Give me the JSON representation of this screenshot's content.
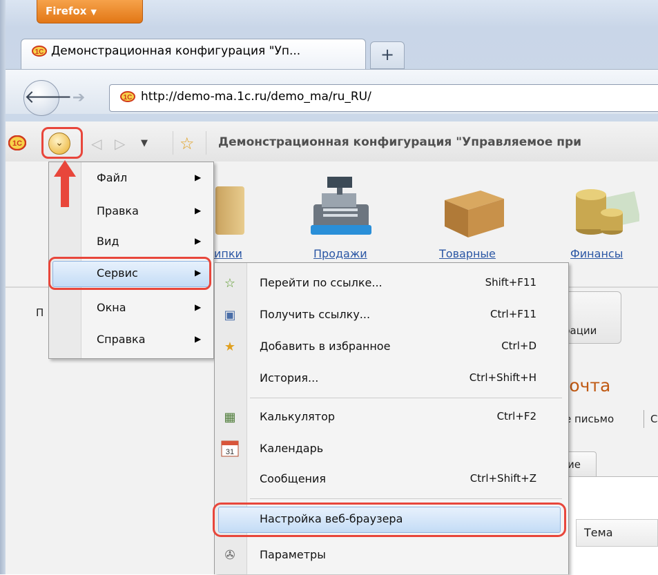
{
  "browser": {
    "menu_button_label": "Firefox",
    "tab_title": "Демонстрационная конфигурация \"Уп...",
    "new_tab_label": "+",
    "url": "http://demo-ma.1c.ru/demo_ma/ru_RU/"
  },
  "app": {
    "logo_text": "1C",
    "title": "Демонстрационная конфигурация \"Управляемое при"
  },
  "sections": [
    {
      "label": "ипки"
    },
    {
      "label": "Продажи"
    },
    {
      "label": "Товарные"
    },
    {
      "label": "Финансы"
    }
  ],
  "content": {
    "side_item": "П",
    "panel_tab_label": "рации",
    "mail_title": "почта",
    "mail_command": "е письмо",
    "mail_command_2": "С",
    "mail_tab_label": "ие",
    "grid_column": "Тема"
  },
  "main_menu": {
    "items": [
      {
        "label": "Файл",
        "arrow": "▶"
      },
      {
        "label": "Правка",
        "arrow": "▶"
      },
      {
        "label": "Вид",
        "arrow": "▶"
      },
      {
        "label": "Сервис",
        "arrow": "▶"
      },
      {
        "label": "Окна",
        "arrow": "▶"
      },
      {
        "label": "Справка",
        "arrow": "▶"
      }
    ],
    "highlighted": "Сервис"
  },
  "service_menu": {
    "items": [
      {
        "label": "Перейти по ссылке...",
        "shortcut": "Shift+F11",
        "icon": "go-to-link-icon"
      },
      {
        "label": "Получить ссылку...",
        "shortcut": "Ctrl+F11",
        "icon": "get-link-icon"
      },
      {
        "label": "Добавить в избранное",
        "shortcut": "Ctrl+D",
        "icon": "add-favorite-icon"
      },
      {
        "label": "История...",
        "shortcut": "Ctrl+Shift+H",
        "icon": ""
      },
      {
        "label": "Калькулятор",
        "shortcut": "Ctrl+F2",
        "icon": "calculator-icon"
      },
      {
        "label": "Календарь",
        "shortcut": "",
        "icon": "calendar-icon"
      },
      {
        "label": "Сообщения",
        "shortcut": "Ctrl+Shift+Z",
        "icon": ""
      },
      {
        "label": "Настройка веб-браузера",
        "shortcut": "",
        "icon": ""
      },
      {
        "label": "Параметры",
        "shortcut": "",
        "icon": "settings-icon"
      }
    ],
    "highlighted": "Настройка веб-браузера",
    "calendar_day": "31"
  },
  "colors": {
    "annotation_red": "#e8463b",
    "firefox_orange": "#e27716",
    "highlight_blue": "#c4dcf6",
    "mail_title": "#c05a14"
  }
}
